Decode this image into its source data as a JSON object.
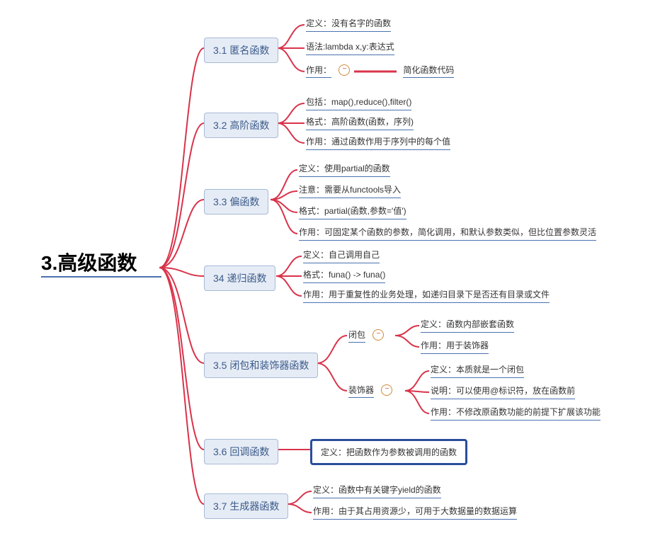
{
  "root": {
    "title": "3.高级函数"
  },
  "sections": [
    {
      "id": "s31",
      "label": "3.1 匿名函数",
      "leaves": [
        "定义：没有名字的函数",
        "语法:lambda x,y:表达式"
      ],
      "collapsed_leaf": {
        "prefix": "作用：",
        "rest": "简化函数代码"
      }
    },
    {
      "id": "s32",
      "label": "3.2 高阶函数",
      "leaves": [
        "包括：map(),reduce(),filter()",
        "格式：高阶函数(函数，序列)",
        "作用：通过函数作用于序列中的每个值"
      ]
    },
    {
      "id": "s33",
      "label": "3.3 偏函数",
      "leaves": [
        "定义：使用partial的函数",
        "注意：需要从functools导入",
        "格式：partial(函数,参数='值')",
        "作用：可固定某个函数的参数，简化调用，和默认参数类似，但比位置参数灵活"
      ]
    },
    {
      "id": "s34",
      "label": "34 递归函数",
      "leaves": [
        "定义：自己调用自己",
        "格式：funa() -> funa()",
        "作用：用于重复性的业务处理，如递归目录下是否还有目录或文件"
      ]
    },
    {
      "id": "s35",
      "label": "3.5 闭包和装饰器函数",
      "sub": [
        {
          "label": "闭包",
          "leaves": [
            "定义：函数内部嵌套函数",
            "作用：用于装饰器"
          ]
        },
        {
          "label": "装饰器",
          "leaves": [
            "定义：本质就是一个闭包",
            "说明：可以使用@标识符，放在函数前",
            "作用：不修改原函数功能的前提下扩展该功能"
          ]
        }
      ]
    },
    {
      "id": "s36",
      "label": "3.6 回调函数",
      "boxed_leaf": "定义：把函数作为参数被调用的函数"
    },
    {
      "id": "s37",
      "label": "3.7 生成器函数",
      "leaves": [
        "定义：函数中有关键字yield的函数",
        "作用：由于其占用资源少，可用于大数据量的数据运算"
      ]
    }
  ],
  "chart_data": {
    "type": "tree",
    "title": "3.高级函数",
    "root": "3.高级函数",
    "children": [
      {
        "node": "3.1 匿名函数",
        "children": [
          "定义：没有名字的函数",
          "语法:lambda x,y:表达式",
          {
            "node": "作用：",
            "collapsed": true,
            "children": [
              "简化函数代码"
            ]
          }
        ]
      },
      {
        "node": "3.2 高阶函数",
        "children": [
          "包括：map(),reduce(),filter()",
          "格式：高阶函数(函数，序列)",
          "作用：通过函数作用于序列中的每个值"
        ]
      },
      {
        "node": "3.3 偏函数",
        "children": [
          "定义：使用partial的函数",
          "注意：需要从functools导入",
          "格式：partial(函数,参数='值')",
          "作用：可固定某个函数的参数，简化调用，和默认参数类似，但比位置参数灵活"
        ]
      },
      {
        "node": "34 递归函数",
        "children": [
          "定义：自己调用自己",
          "格式：funa() -> funa()",
          "作用：用于重复性的业务处理，如递归目录下是否还有目录或文件"
        ]
      },
      {
        "node": "3.5 闭包和装饰器函数",
        "children": [
          {
            "node": "闭包",
            "collapsed": true,
            "children": [
              "定义：函数内部嵌套函数",
              "作用：用于装饰器"
            ]
          },
          {
            "node": "装饰器",
            "collapsed": true,
            "children": [
              "定义：本质就是一个闭包",
              "说明：可以使用@标识符，放在函数前",
              "作用：不修改原函数功能的前提下扩展该功能"
            ]
          }
        ]
      },
      {
        "node": "3.6 回调函数",
        "selected": true,
        "children": [
          "定义：把函数作为参数被调用的函数"
        ]
      },
      {
        "node": "3.7 生成器函数",
        "children": [
          "定义：函数中有关键字yield的函数",
          "作用：由于其占用资源少，可用于大数据量的数据运算"
        ]
      }
    ]
  }
}
